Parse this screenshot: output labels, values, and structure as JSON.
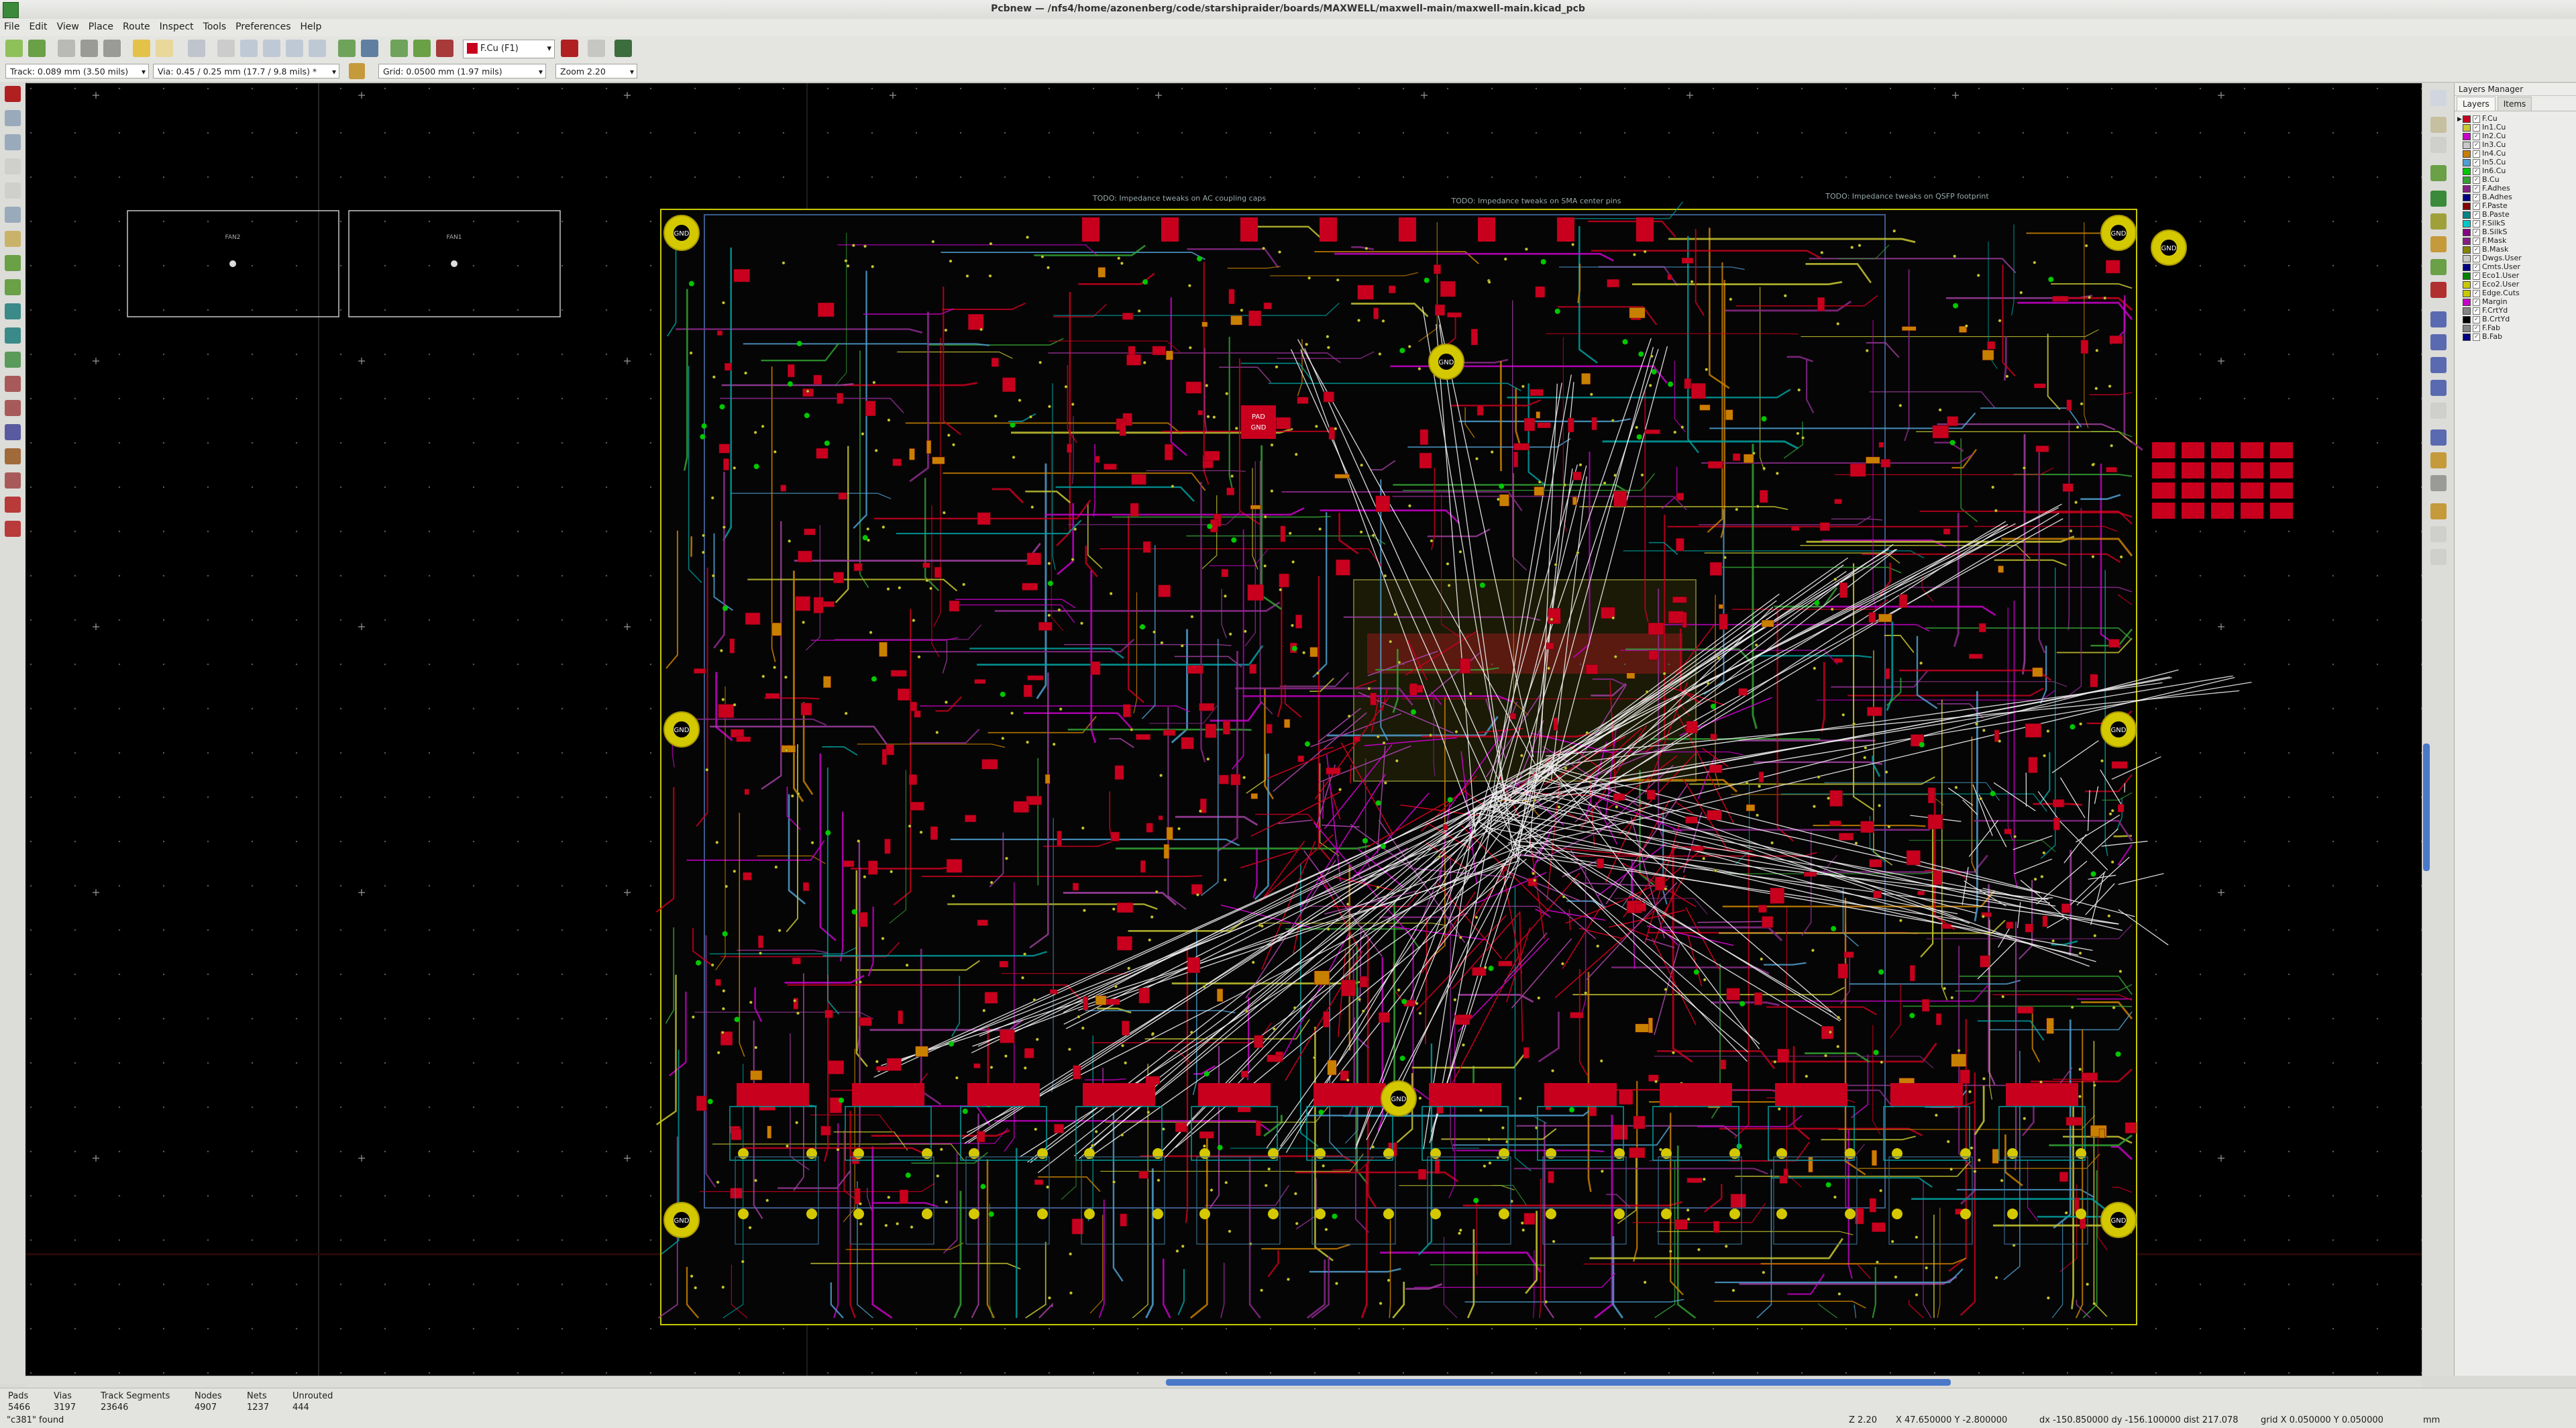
{
  "window": {
    "title": "Pcbnew — /nfs4/home/azonenberg/code/starshipraider/boards/MAXWELL/maxwell-main/maxwell-main.kicad_pcb"
  },
  "menu": [
    "File",
    "Edit",
    "View",
    "Place",
    "Route",
    "Inspect",
    "Tools",
    "Preferences",
    "Help"
  ],
  "toolbar": {
    "active_layer": "F.Cu (F1)"
  },
  "settings": {
    "track": "Track: 0.089 mm (3.50 mils)",
    "via": "Via: 0.45 / 0.25 mm (17.7 / 9.8 mils) *",
    "grid": "Grid: 0.0500 mm (1.97 mils)",
    "zoom": "Zoom 2.20"
  },
  "layers_manager": {
    "title": "Layers Manager",
    "tabs": [
      "Layers",
      "Items"
    ],
    "layers": [
      {
        "name": "F.Cu",
        "color": "#c8001e"
      },
      {
        "name": "In1.Cu",
        "color": "#c8c832"
      },
      {
        "name": "In2.Cu",
        "color": "#c800c8"
      },
      {
        "name": "In3.Cu",
        "color": "#c8c8c8"
      },
      {
        "name": "In4.Cu",
        "color": "#c88000"
      },
      {
        "name": "In5.Cu",
        "color": "#4f9fd0"
      },
      {
        "name": "In6.Cu",
        "color": "#00c800"
      },
      {
        "name": "B.Cu",
        "color": "#32a032"
      },
      {
        "name": "F.Adhes",
        "color": "#841f84"
      },
      {
        "name": "B.Adhes",
        "color": "#000084"
      },
      {
        "name": "F.Paste",
        "color": "#840000"
      },
      {
        "name": "B.Paste",
        "color": "#008484"
      },
      {
        "name": "F.SilkS",
        "color": "#00c8c8"
      },
      {
        "name": "B.SilkS",
        "color": "#840084"
      },
      {
        "name": "F.Mask",
        "color": "#841f84"
      },
      {
        "name": "B.Mask",
        "color": "#848400"
      },
      {
        "name": "Dwgs.User",
        "color": "#c8c8c8"
      },
      {
        "name": "Cmts.User",
        "color": "#000084"
      },
      {
        "name": "Eco1.User",
        "color": "#008400"
      },
      {
        "name": "Eco2.User",
        "color": "#c8c800"
      },
      {
        "name": "Edge.Cuts",
        "color": "#c8c800"
      },
      {
        "name": "Margin",
        "color": "#c800c8"
      },
      {
        "name": "F.CrtYd",
        "color": "#848484"
      },
      {
        "name": "B.CrtYd",
        "color": "#000000"
      },
      {
        "name": "F.Fab",
        "color": "#848484"
      },
      {
        "name": "B.Fab",
        "color": "#000084"
      }
    ]
  },
  "board": {
    "notes": [
      "TODO: Impedance tweaks on AC coupling caps",
      "TODO: Impedance tweaks on SMA center pins",
      "TODO: Impedance tweaks on QSFP footprint"
    ],
    "fan_labels": [
      "FAN2",
      "FAN1"
    ],
    "mount_label": "GND",
    "pad_labels": [
      "PAD",
      "GND"
    ]
  },
  "status": {
    "stats": [
      {
        "label": "Pads",
        "value": "5466"
      },
      {
        "label": "Vias",
        "value": "3197"
      },
      {
        "label": "Track Segments",
        "value": "23646"
      },
      {
        "label": "Nodes",
        "value": "4907"
      },
      {
        "label": "Nets",
        "value": "1237"
      },
      {
        "label": "Unrouted",
        "value": "444"
      }
    ],
    "message": "\"c381\" found",
    "zoom": "Z 2.20",
    "xy": "X 47.650000  Y -2.800000",
    "delta": "dx -150.850000  dy -156.100000  dist 217.078",
    "grid": "grid X 0.050000  Y 0.050000",
    "units": "mm"
  }
}
